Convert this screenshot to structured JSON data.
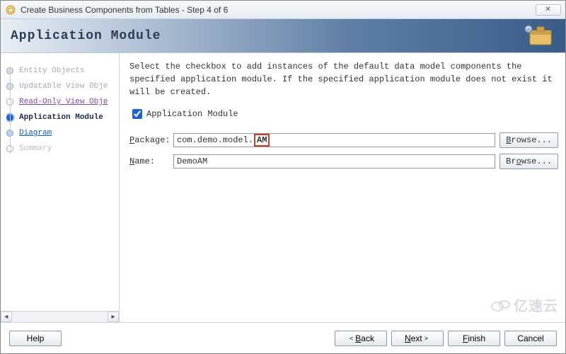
{
  "window": {
    "title": "Create Business Components from Tables - Step 4 of 6",
    "close_glyph": "✕"
  },
  "banner": {
    "title": "Application Module"
  },
  "sidebar": {
    "steps": [
      {
        "label": "Entity Objects",
        "state": "past"
      },
      {
        "label": "Updatable View Obje",
        "state": "past"
      },
      {
        "label": "Read-Only View Obje",
        "state": "visited"
      },
      {
        "label": "Application Module",
        "state": "current"
      },
      {
        "label": "Diagram",
        "state": "link"
      },
      {
        "label": "Summary",
        "state": "disabled"
      }
    ]
  },
  "main": {
    "description": "Select the checkbox to add instances of the default data model components the specified application module.  If the specified application module does not exist it will be created.",
    "checkbox": {
      "label": "Application Module",
      "checked": true
    },
    "fields": {
      "package": {
        "label": "Package:",
        "mnemonic": "P",
        "value_prefix": "com.demo.model.",
        "value_highlight": "AM",
        "browse": "Browse..."
      },
      "name": {
        "label": "Name:",
        "mnemonic": "N",
        "value": "DemoAM",
        "browse": "Browse..."
      }
    }
  },
  "footer": {
    "help": "Help",
    "back": "Back",
    "next": "Next",
    "finish": "Finish",
    "cancel": "Cancel"
  },
  "watermark": "亿速云"
}
